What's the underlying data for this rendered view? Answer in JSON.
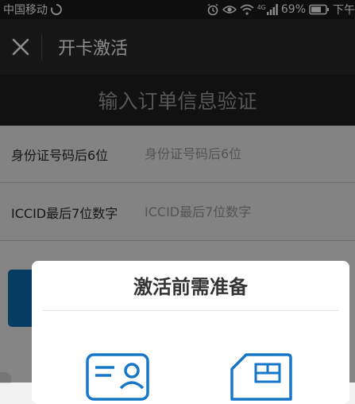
{
  "status_bar": {
    "carrier": "中国移动",
    "network": "4G",
    "battery": "69%",
    "time": "下午"
  },
  "navbar": {
    "title": "开卡激活"
  },
  "header": {
    "banner_text": "输入订单信息验证"
  },
  "form": {
    "id_row": {
      "label": "身份证号码后6位",
      "placeholder": "身份证号码后6位"
    },
    "iccid_row": {
      "label": "ICCID最后7位数字",
      "placeholder": "ICCID最后7位数字"
    }
  },
  "modal": {
    "title": "激活前需准备"
  },
  "colors": {
    "accent_blue": "#0e6fb3",
    "modal_icon_blue": "#1676c8"
  }
}
